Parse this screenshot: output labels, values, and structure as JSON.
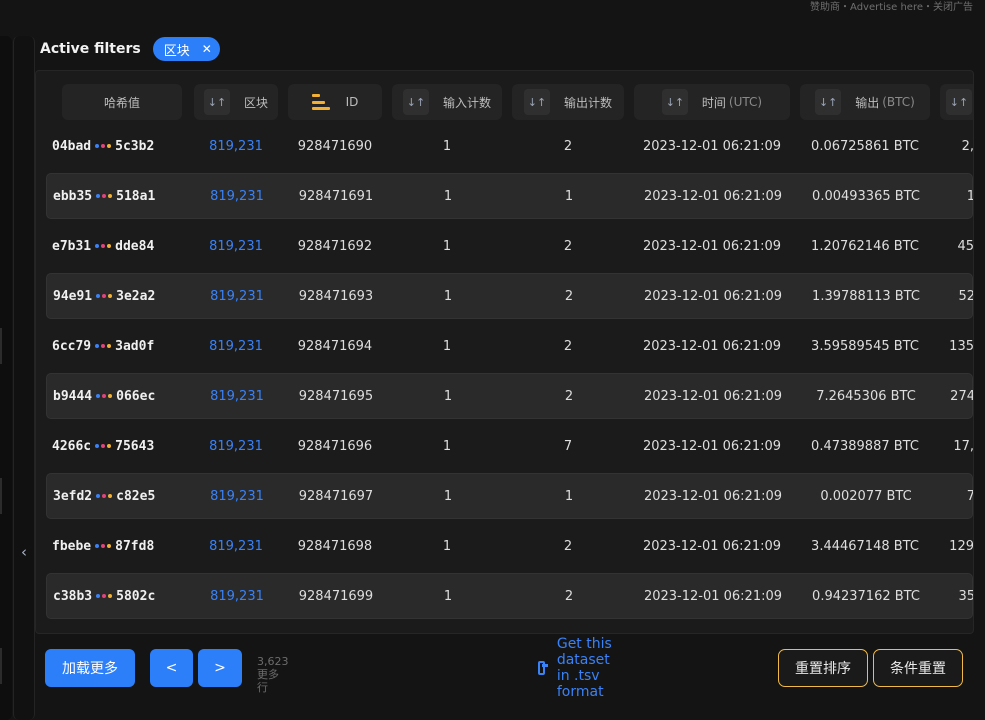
{
  "topnote": "赞助商・Advertise here・关闭广告",
  "filters": {
    "label": "Active filters",
    "chip": "区块",
    "chip_close": "✕"
  },
  "columns": [
    {
      "label": "哈希值",
      "unit": ""
    },
    {
      "label": "区块",
      "unit": ""
    },
    {
      "label": "ID",
      "unit": ""
    },
    {
      "label": "输入计数",
      "unit": ""
    },
    {
      "label": "输出计数",
      "unit": ""
    },
    {
      "label": "时间",
      "unit": "(UTC)"
    },
    {
      "label": "输出",
      "unit": "(BTC)"
    }
  ],
  "rows": [
    {
      "hash_a": "04bad",
      "hash_b": "5c3b2",
      "block": "819,231",
      "id": "928471690",
      "inputs": "1",
      "outputs": "2",
      "time": "2023-12-01 06:21:09",
      "btc": "0.06725861 BTC",
      "extra": "2,"
    },
    {
      "hash_a": "ebb35",
      "hash_b": "518a1",
      "block": "819,231",
      "id": "928471691",
      "inputs": "1",
      "outputs": "1",
      "time": "2023-12-01 06:21:09",
      "btc": "0.00493365 BTC",
      "extra": "1"
    },
    {
      "hash_a": "e7b31",
      "hash_b": "dde84",
      "block": "819,231",
      "id": "928471692",
      "inputs": "1",
      "outputs": "2",
      "time": "2023-12-01 06:21:09",
      "btc": "1.20762146 BTC",
      "extra": "45"
    },
    {
      "hash_a": "94e91",
      "hash_b": "3e2a2",
      "block": "819,231",
      "id": "928471693",
      "inputs": "1",
      "outputs": "2",
      "time": "2023-12-01 06:21:09",
      "btc": "1.39788113 BTC",
      "extra": "52"
    },
    {
      "hash_a": "6cc79",
      "hash_b": "3ad0f",
      "block": "819,231",
      "id": "928471694",
      "inputs": "1",
      "outputs": "2",
      "time": "2023-12-01 06:21:09",
      "btc": "3.59589545 BTC",
      "extra": "135"
    },
    {
      "hash_a": "b9444",
      "hash_b": "066ec",
      "block": "819,231",
      "id": "928471695",
      "inputs": "1",
      "outputs": "2",
      "time": "2023-12-01 06:21:09",
      "btc": "7.2645306 BTC",
      "extra": "274"
    },
    {
      "hash_a": "4266c",
      "hash_b": "75643",
      "block": "819,231",
      "id": "928471696",
      "inputs": "1",
      "outputs": "7",
      "time": "2023-12-01 06:21:09",
      "btc": "0.47389887 BTC",
      "extra": "17,"
    },
    {
      "hash_a": "3efd2",
      "hash_b": "c82e5",
      "block": "819,231",
      "id": "928471697",
      "inputs": "1",
      "outputs": "1",
      "time": "2023-12-01 06:21:09",
      "btc": "0.002077 BTC",
      "extra": "7"
    },
    {
      "hash_a": "fbebe",
      "hash_b": "87fd8",
      "block": "819,231",
      "id": "928471698",
      "inputs": "1",
      "outputs": "2",
      "time": "2023-12-01 06:21:09",
      "btc": "3.44467148 BTC",
      "extra": "129"
    },
    {
      "hash_a": "c38b3",
      "hash_b": "5802c",
      "block": "819,231",
      "id": "928471699",
      "inputs": "1",
      "outputs": "2",
      "time": "2023-12-01 06:21:09",
      "btc": "0.94237162 BTC",
      "extra": "35"
    }
  ],
  "footer": {
    "load_more": "加载更多",
    "prev": "<",
    "next": ">",
    "count": "3,623",
    "count_suffix": "更多行",
    "tsv": "Get this dataset in .tsv format",
    "reset_sort": "重置排序",
    "reset_filters": "条件重置"
  },
  "sidebar": {
    "collapse": "‹"
  },
  "colors": {
    "accent": "#2d7ff9",
    "block_link": "#3a82f7",
    "outline": "#f0b94a",
    "sort_active": "#f2b134",
    "dot_a": "#3a82f7",
    "dot_b": "#e0457b",
    "dot_c": "#f2b134"
  }
}
